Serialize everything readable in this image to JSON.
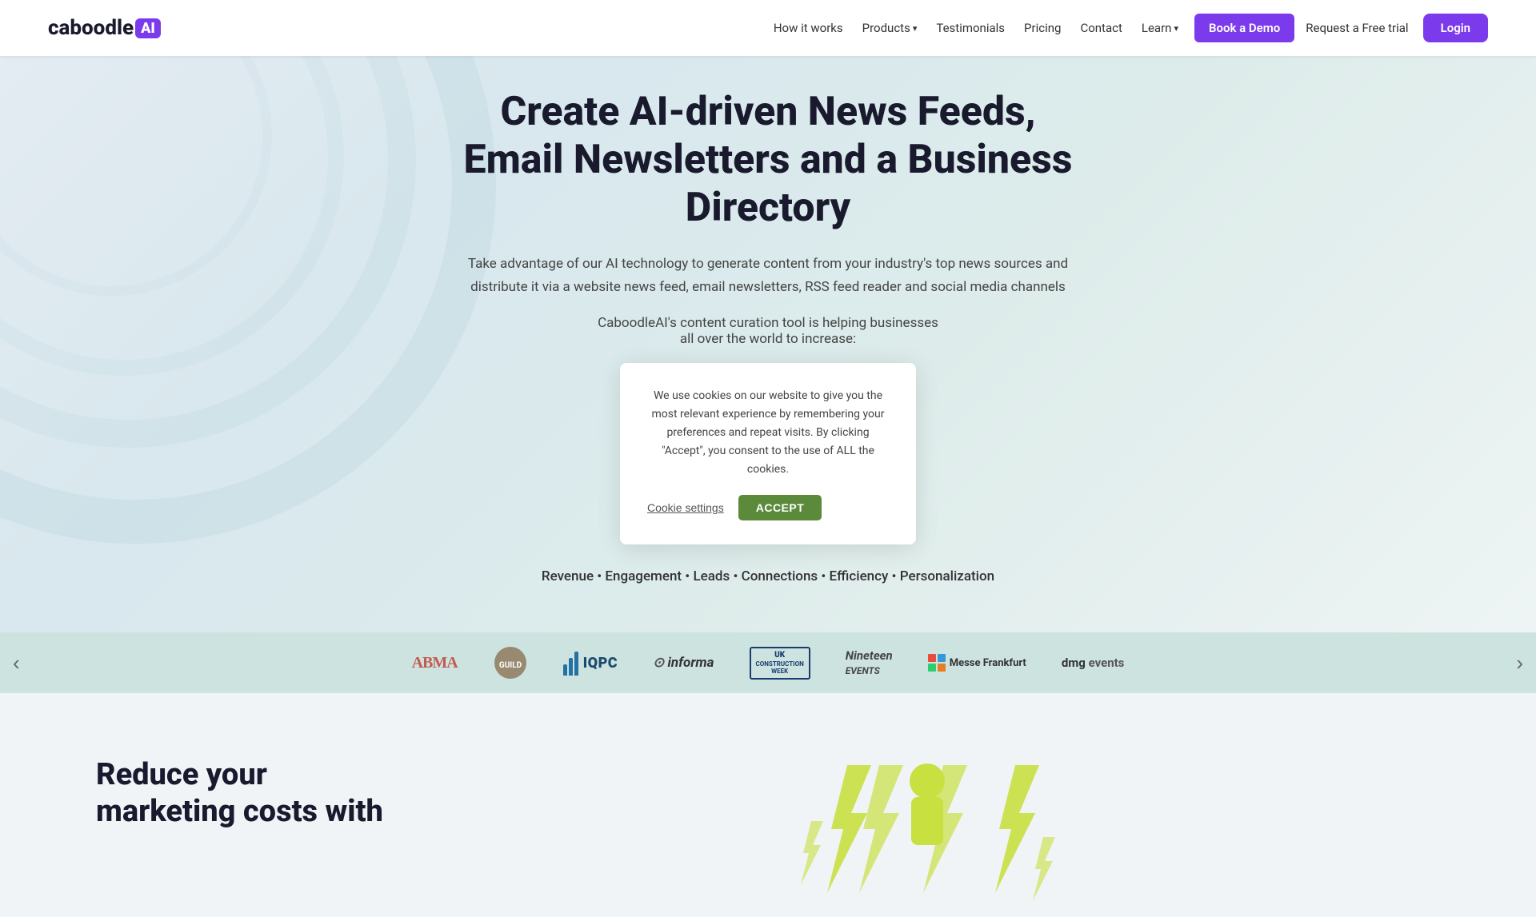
{
  "logo": {
    "brand": "caboodle",
    "ai_badge": "AI"
  },
  "nav": {
    "links": [
      {
        "id": "how-it-works",
        "label": "How it works",
        "has_arrow": false
      },
      {
        "id": "products",
        "label": "Products",
        "has_arrow": true
      },
      {
        "id": "testimonials",
        "label": "Testimonials",
        "has_arrow": false
      },
      {
        "id": "pricing",
        "label": "Pricing",
        "has_arrow": false
      },
      {
        "id": "contact",
        "label": "Contact",
        "has_arrow": false
      },
      {
        "id": "learn",
        "label": "Learn",
        "has_arrow": true
      }
    ],
    "book_demo": "Book a Demo",
    "free_trial": "Request a Free trial",
    "login": "Login"
  },
  "hero": {
    "title": "Create AI-driven News Feeds, Email Newsletters and a Business Directory",
    "subtitle": "Take advantage of our AI technology to generate content from your industry's top news sources and distribute it via a website news feed, email newsletters, RSS feed reader and social media channels",
    "helper_line1": "CaboodleAI's content curation tool is helping businesses",
    "helper_line2": "all over the world to increase:",
    "benefits": "Revenue • Engagement • Leads • Connections • Efficiency • Personalization"
  },
  "cookie_banner": {
    "text": "We use cookies on our website to give you the most relevant experience by remembering your preferences and repeat visits. By clicking \"Accept\", you consent to the use of ALL the cookies.",
    "settings_label": "Cookie settings",
    "accept_label": "ACCEPT"
  },
  "logos": {
    "prev_arrow": "‹",
    "next_arrow": "›",
    "items": [
      {
        "id": "abma",
        "name": "ABMA"
      },
      {
        "id": "guild",
        "name": "Guild"
      },
      {
        "id": "iqpc",
        "name": "IQPC"
      },
      {
        "id": "informa",
        "name": "informa"
      },
      {
        "id": "uk-construction",
        "name": "UK Construction Week"
      },
      {
        "id": "nineteen",
        "name": "Nineteen Events"
      },
      {
        "id": "messe-frankfurt",
        "name": "Messe Frankfurt"
      },
      {
        "id": "dmg-events",
        "name": "dmg events"
      }
    ]
  },
  "bottom": {
    "title_line1": "Reduce your",
    "title_line2": "marketing costs with"
  },
  "colors": {
    "purple": "#7c3aed",
    "green_accept": "#5a8a3a",
    "hero_bg_start": "#e8f0f5",
    "hero_bg_end": "#f0f5f5",
    "logos_bg": "#d6eae8"
  }
}
